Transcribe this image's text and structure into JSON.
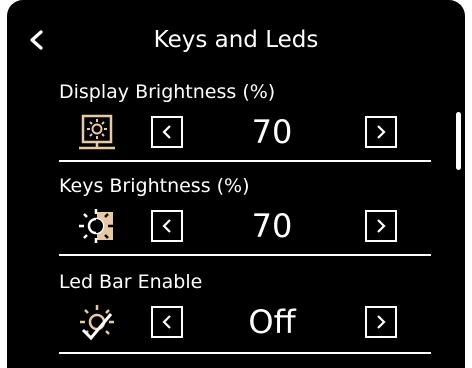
{
  "header": {
    "title": "Keys and Leds",
    "back_icon": "chevron-left-icon"
  },
  "settings": [
    {
      "label": "Display Brightness (%)",
      "value": "70",
      "icon": "display-brightness-icon"
    },
    {
      "label": "Keys Brightness (%)",
      "value": "70",
      "icon": "keys-brightness-icon"
    },
    {
      "label": "Led Bar Enable",
      "value": "Off",
      "icon": "led-bar-icon"
    }
  ],
  "colors": {
    "accent": "#e8c9a5",
    "background": "#000000",
    "foreground": "#ffffff"
  }
}
